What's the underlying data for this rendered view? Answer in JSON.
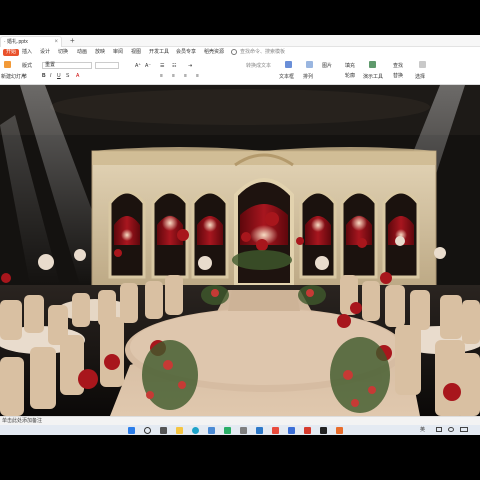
{
  "app": {
    "document_tab": "· 婚礼.pptx",
    "new_tab": "+"
  },
  "menu": {
    "items": [
      "开始",
      "插入",
      "设计",
      "切换",
      "动画",
      "放映",
      "审阅",
      "视图",
      "开发工具",
      "会员专享",
      "稻壳资源"
    ],
    "search": "查找命令、搜索模板"
  },
  "toolbar": {
    "new_slide": "新建幻灯片",
    "layout": "版式",
    "section": "节",
    "font_select": "重置",
    "textbox": "文本框",
    "arrange": "排列",
    "picture": "图片",
    "fill": "填充",
    "outline": "轮廓",
    "convert_text": "转换成文本",
    "presenter_tools": "演示工具",
    "find": "查找",
    "replace": "替换",
    "select": "选择"
  },
  "slide": {
    "kind": "婚礼舞台效果图",
    "palette": {
      "backdrop": "#d8c6a4",
      "drape": "#8e1118",
      "carpet": "#d8bfa4",
      "floor": "#14110f",
      "rose": "#a8161c",
      "chair": "#dcc3a6"
    }
  },
  "status": {
    "notes_hint": "单击此处添加备注"
  },
  "taskbar": {
    "icons": [
      "windows-icon",
      "search-icon",
      "task-view-icon",
      "folder-icon",
      "edge-icon",
      "store-icon",
      "wechat-icon",
      "settings-icon",
      "wps-icon",
      "pdf-icon",
      "mail-icon",
      "office-icon",
      "terminal-icon",
      "notes-icon"
    ],
    "ime": "英",
    "tray_text": "英"
  }
}
